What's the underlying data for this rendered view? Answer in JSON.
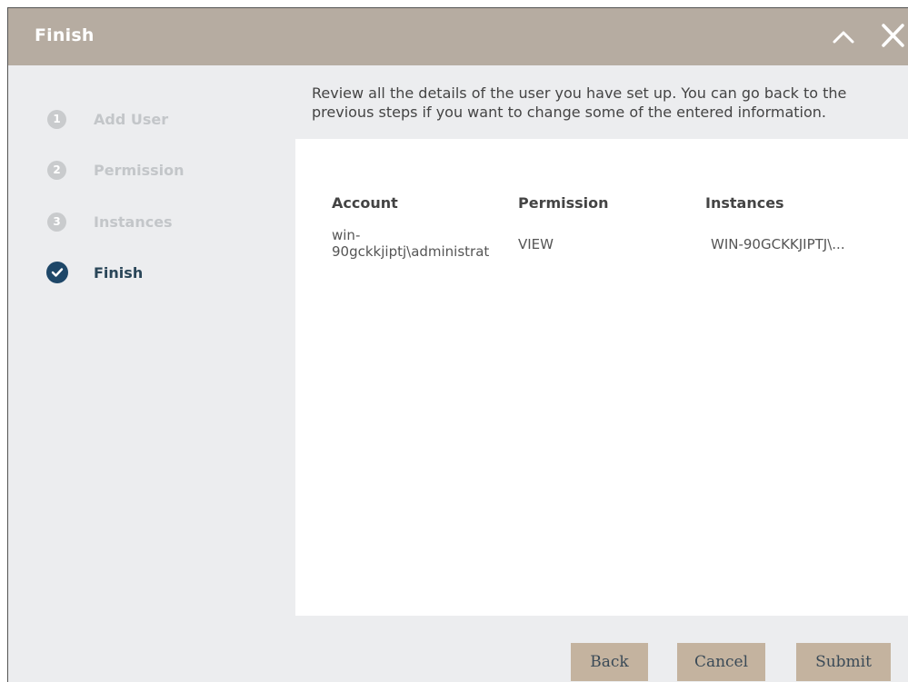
{
  "dialog": {
    "title": "Finish"
  },
  "steps": [
    {
      "number": "1",
      "label": "Add User",
      "state": "done"
    },
    {
      "number": "2",
      "label": "Permission",
      "state": "done"
    },
    {
      "number": "3",
      "label": "Instances",
      "state": "done"
    },
    {
      "number": "",
      "label": "Finish",
      "state": "active"
    }
  ],
  "intro": {
    "line1": "Review all the details of the user you have set up. You can go back to the",
    "line2": "previous steps if you want to change some of the entered information."
  },
  "table": {
    "headers": [
      "Account",
      "Permission",
      "Instances"
    ],
    "rows": [
      {
        "account_line1": "win-",
        "account_line2": "90gckkjiptj\\administrat",
        "permission": "VIEW",
        "instances": "WIN-90GCKKJIPTJ\\..."
      }
    ]
  },
  "footer": {
    "back_label": "Back",
    "cancel_label": "Cancel",
    "submit_label": "Submit"
  },
  "colors": {
    "titlebar": "#b6aca1",
    "sidebar": "#ecedef",
    "active_step": "#1e4768",
    "button": "#c4b39f"
  }
}
